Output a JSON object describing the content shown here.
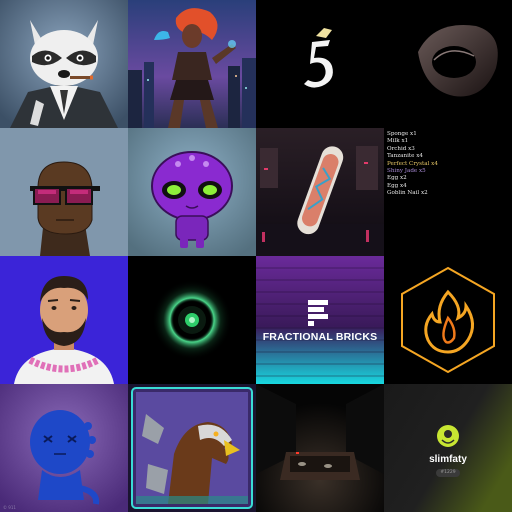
{
  "gallery": {
    "tiles": [
      {
        "label": "raccoon"
      },
      {
        "label": "cyber-warrior"
      },
      {
        "label": "five-logo"
      },
      {
        "label": "abstract-ring"
      },
      {
        "label": "sunglasses-avatar"
      },
      {
        "label": "purple-alien"
      },
      {
        "label": "skateboard"
      },
      {
        "label": "inventory"
      },
      {
        "label": "bearded-man"
      },
      {
        "label": "glowing-orb"
      },
      {
        "label": "fractional-bricks"
      },
      {
        "label": "flame-hexagon"
      },
      {
        "label": "blue-creature"
      },
      {
        "label": "eagle-card"
      },
      {
        "label": "dark-room"
      },
      {
        "label": "slimfaty"
      }
    ]
  },
  "inventory": {
    "items": [
      {
        "text": "Sponge x1",
        "color": "#e8e8e8"
      },
      {
        "text": "Milk x1",
        "color": "#e8e8e8"
      },
      {
        "text": "Orchid x3",
        "color": "#e8e8e8"
      },
      {
        "text": "Tanzanite x4",
        "color": "#e8e8e8"
      },
      {
        "text": "Perfect Crystal x4",
        "color": "#e7c766"
      },
      {
        "text": "Shiny Jade x5",
        "color": "#a98bd6"
      },
      {
        "text": "Egg x2",
        "color": "#e8e8e8"
      },
      {
        "text": "Egg x4",
        "color": "#e8e8e8"
      },
      {
        "text": "Goblin Nail x2",
        "color": "#e8e8e8"
      }
    ]
  },
  "fractional_bricks": {
    "title": "FRACTIONAL BRICKS"
  },
  "slimfaty": {
    "name": "slimfaty",
    "badge": "#1229"
  },
  "corner_mark": "© 911"
}
